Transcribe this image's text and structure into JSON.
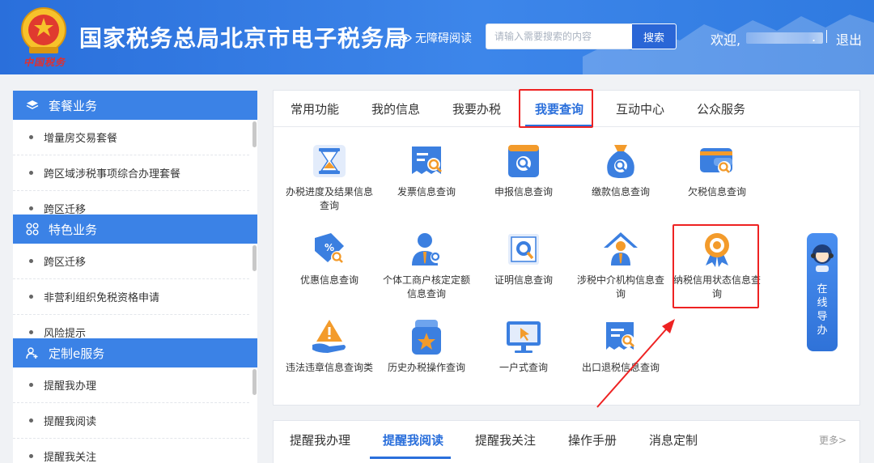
{
  "header": {
    "site_title": "国家税务总局北京市电子税务局",
    "emblem_caption": "中国税务",
    "accessibility_label": "无障碍阅读",
    "search_placeholder": "请输入需要搜索的内容",
    "search_button": "搜索",
    "welcome_text": "欢迎,",
    "welcome_suffix": ".",
    "logout_label": "退出"
  },
  "sidebar": [
    {
      "title": "套餐业务",
      "icon": "layers-icon",
      "items": [
        "增量房交易套餐",
        "跨区域涉税事项综合办理套餐",
        "跨区迁移"
      ]
    },
    {
      "title": "特色业务",
      "icon": "grid-icon",
      "items": [
        "跨区迁移",
        "非营利组织免税资格申请",
        "风险提示"
      ]
    },
    {
      "title": "定制e服务",
      "icon": "user-add-icon",
      "items": [
        "提醒我办理",
        "提醒我阅读",
        "提醒我关注"
      ]
    }
  ],
  "main": {
    "tabs": [
      "常用功能",
      "我的信息",
      "我要办税",
      "我要查询",
      "互动中心",
      "公众服务"
    ],
    "active_tab": "我要查询",
    "tiles": [
      {
        "label": "办税进度及结果信息查询",
        "icon": "hourglass-icon"
      },
      {
        "label": "发票信息查询",
        "icon": "invoice-search-icon"
      },
      {
        "label": "申报信息查询",
        "icon": "declaration-search-icon"
      },
      {
        "label": "缴款信息查询",
        "icon": "money-bag-icon"
      },
      {
        "label": "欠税信息查询",
        "icon": "wallet-icon"
      },
      {
        "label": "优惠信息查询",
        "icon": "discount-tag-icon"
      },
      {
        "label": "个体工商户核定定额信息查询",
        "icon": "business-person-icon"
      },
      {
        "label": "证明信息查询",
        "icon": "certificate-search-icon"
      },
      {
        "label": "涉税中介机构信息查询",
        "icon": "agency-house-icon"
      },
      {
        "label": "纳税信用状态信息查询",
        "icon": "credit-medal-icon"
      },
      {
        "label": "违法违章信息查询类",
        "icon": "warning-hand-icon"
      },
      {
        "label": "历史办税操作查询",
        "icon": "history-star-icon"
      },
      {
        "label": "一户式查询",
        "icon": "monitor-cursor-icon"
      },
      {
        "label": "出口退税信息查询",
        "icon": "export-refund-icon"
      }
    ]
  },
  "guide": {
    "label": "在线导办"
  },
  "bottom": {
    "tabs": [
      "提醒我办理",
      "提醒我阅读",
      "提醒我关注",
      "操作手册",
      "消息定制"
    ],
    "active_tab": "提醒我阅读",
    "more_label": "更多>"
  },
  "colors": {
    "primary": "#2a6fdb",
    "header_bg": "#3d86ea",
    "annotation_red": "#e22222",
    "icon_orange": "#f39b2b"
  }
}
